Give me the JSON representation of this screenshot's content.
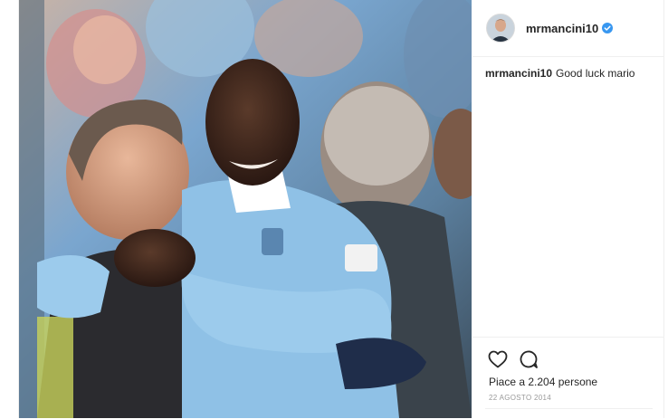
{
  "post": {
    "username": "mrmancini10",
    "verified": true,
    "caption_user": "mrmancini10",
    "caption_text": "Good luck mario",
    "likes_text": "Piace a 2.204 persone",
    "date_text": "22 AGOSTO 2014"
  },
  "icons": {
    "like": "heart-icon",
    "comment": "comment-icon",
    "verified": "verified-badge-icon"
  },
  "colors": {
    "verified_blue": "#3897f0",
    "text": "#262626",
    "muted": "#999999",
    "divider": "#efefef"
  }
}
